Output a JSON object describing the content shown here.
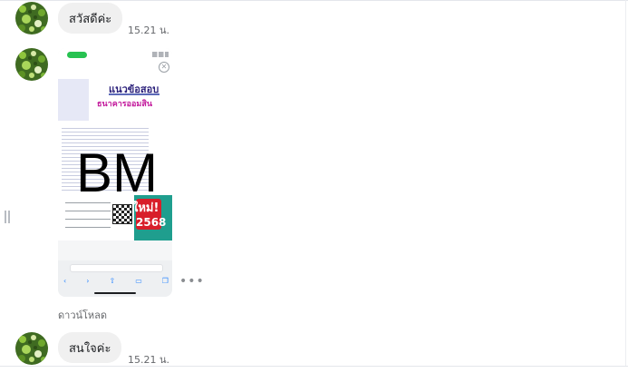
{
  "messages": [
    {
      "text": "สวัสดีค่ะ",
      "time": "15.21 น."
    },
    {
      "text": "สนใจค่ะ",
      "time": "15.21 น."
    }
  ],
  "attachment": {
    "poster_title": "แนวข้อสอบ",
    "poster_subtitle": "ธนาคารออมสิน",
    "poster_logo": "BM",
    "poster_badge_new": "ใหม่!",
    "poster_badge_year": "2568",
    "download_label": "ดาวน์โหลด"
  },
  "icons": [
    "avatar-image",
    "close-icon",
    "more-options-icon",
    "back-icon",
    "forward-icon",
    "share-icon",
    "bookmarks-icon",
    "tabs-icon",
    "resize-handle-icon"
  ],
  "colors": {
    "bubble": "#f0f0f0",
    "time_text": "#65676b",
    "status_green": "#27c251",
    "badge_red": "#d81e2a",
    "badge_teal": "#1f9e8e"
  }
}
